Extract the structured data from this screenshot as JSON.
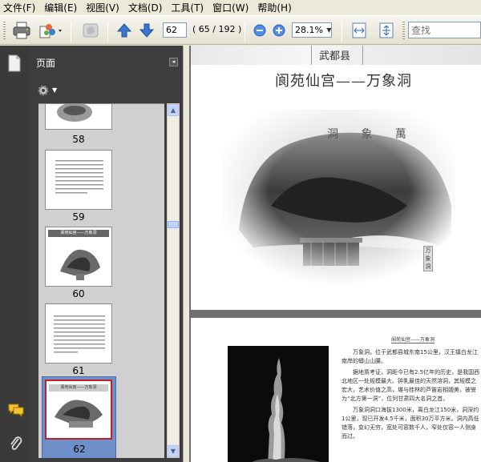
{
  "menu": [
    "文件(F)",
    "编辑(E)",
    "视图(V)",
    "文档(D)",
    "工具(T)",
    "窗口(W)",
    "帮助(H)"
  ],
  "toolbar": {
    "page_value": "62",
    "page_count": "( 65 / 192 )",
    "zoom_value": "28.1%",
    "search_placeholder": "查找"
  },
  "nav_panel": {
    "title": "页面",
    "thumbnails": [
      {
        "label": "58"
      },
      {
        "label": "59"
      },
      {
        "label": "60",
        "heading": "阆苑仙宫——万象洞"
      },
      {
        "label": "61"
      },
      {
        "label": "62",
        "heading": "阆苑仙宫——万象洞"
      }
    ],
    "selected_page": "62"
  },
  "document": {
    "county": "武都县",
    "heading": "阆苑仙宫——万象洞",
    "cave_sign": "洞 象 萬",
    "side_plaque": "万象洞",
    "page2_header": "阆苑仙宫——万象洞",
    "paragraphs": [
      "万象洞，位于武都县城东南15公里，汉王镇白龙江南岸的蟒山山腰。",
      "据地质考证，洞距今已有2.5亿年的历史，是我国西北地区一处规模最大、钟乳最佳的天然溶洞，其规模之宏大，艺术价值之高，堪与桂林的芦笛岩相媲美，被誉为“北方第一洞”，位列甘肃四大名洞之首。",
      "万象洞洞口海拔1300米，离白龙江150米，洞深约1公里，现已开发4.5千米，面积30万平方米。洞内高低错落，变幻无穷，宽处可容数千人，窄处仅容一人侧身而过。"
    ]
  },
  "colors": {
    "nav_bg": "#3d3d3d",
    "doc_bg": "#6f6f6f",
    "selected_thumb_border": "#c0202a",
    "selected_thumb_bg": "#6f8fc8"
  }
}
